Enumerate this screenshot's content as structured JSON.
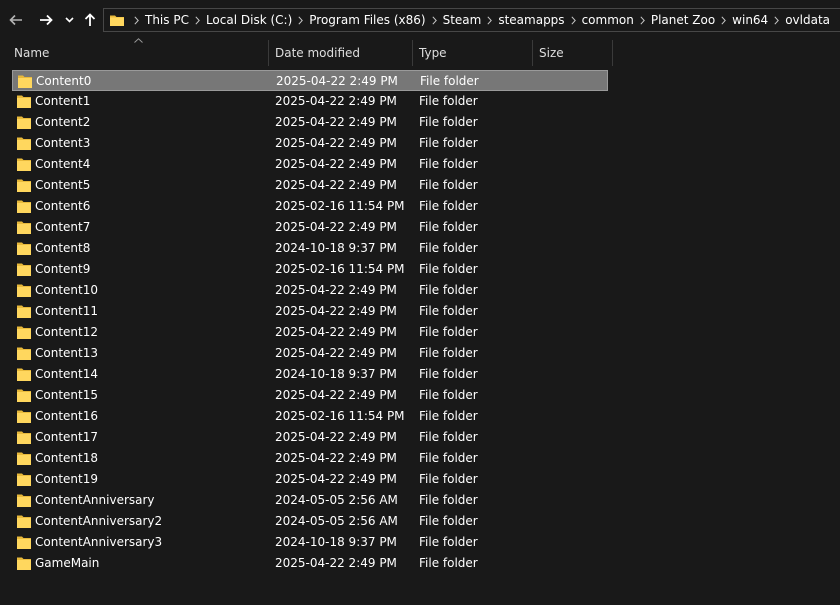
{
  "colors": {
    "background": "#191919",
    "folder_yellow": "#ffd75e",
    "folder_shade": "#e8b93b",
    "selection": "#777777"
  },
  "toolbar": {
    "back_icon": "back-arrow-icon",
    "forward_icon": "forward-arrow-icon",
    "recent_icon": "chevron-down-icon",
    "up_icon": "up-arrow-icon"
  },
  "address": {
    "crumbs": [
      "This PC",
      "Local Disk (C:)",
      "Program Files (x86)",
      "Steam",
      "steamapps",
      "common",
      "Planet Zoo",
      "win64",
      "ovldata"
    ]
  },
  "columns": {
    "name": "Name",
    "date": "Date modified",
    "type": "Type",
    "size": "Size"
  },
  "files": [
    {
      "name": "Content0",
      "date": "2025-04-22 2:49 PM",
      "type": "File folder",
      "selected": true
    },
    {
      "name": "Content1",
      "date": "2025-04-22 2:49 PM",
      "type": "File folder"
    },
    {
      "name": "Content2",
      "date": "2025-04-22 2:49 PM",
      "type": "File folder"
    },
    {
      "name": "Content3",
      "date": "2025-04-22 2:49 PM",
      "type": "File folder"
    },
    {
      "name": "Content4",
      "date": "2025-04-22 2:49 PM",
      "type": "File folder"
    },
    {
      "name": "Content5",
      "date": "2025-04-22 2:49 PM",
      "type": "File folder"
    },
    {
      "name": "Content6",
      "date": "2025-02-16 11:54 PM",
      "type": "File folder"
    },
    {
      "name": "Content7",
      "date": "2025-04-22 2:49 PM",
      "type": "File folder"
    },
    {
      "name": "Content8",
      "date": "2024-10-18 9:37 PM",
      "type": "File folder"
    },
    {
      "name": "Content9",
      "date": "2025-02-16 11:54 PM",
      "type": "File folder"
    },
    {
      "name": "Content10",
      "date": "2025-04-22 2:49 PM",
      "type": "File folder"
    },
    {
      "name": "Content11",
      "date": "2025-04-22 2:49 PM",
      "type": "File folder"
    },
    {
      "name": "Content12",
      "date": "2025-04-22 2:49 PM",
      "type": "File folder"
    },
    {
      "name": "Content13",
      "date": "2025-04-22 2:49 PM",
      "type": "File folder"
    },
    {
      "name": "Content14",
      "date": "2024-10-18 9:37 PM",
      "type": "File folder"
    },
    {
      "name": "Content15",
      "date": "2025-04-22 2:49 PM",
      "type": "File folder"
    },
    {
      "name": "Content16",
      "date": "2025-02-16 11:54 PM",
      "type": "File folder"
    },
    {
      "name": "Content17",
      "date": "2025-04-22 2:49 PM",
      "type": "File folder"
    },
    {
      "name": "Content18",
      "date": "2025-04-22 2:49 PM",
      "type": "File folder"
    },
    {
      "name": "Content19",
      "date": "2025-04-22 2:49 PM",
      "type": "File folder"
    },
    {
      "name": "ContentAnniversary",
      "date": "2024-05-05 2:56 AM",
      "type": "File folder"
    },
    {
      "name": "ContentAnniversary2",
      "date": "2024-05-05 2:56 AM",
      "type": "File folder"
    },
    {
      "name": "ContentAnniversary3",
      "date": "2024-10-18 9:37 PM",
      "type": "File folder"
    },
    {
      "name": "GameMain",
      "date": "2025-04-22 2:49 PM",
      "type": "File folder"
    }
  ]
}
